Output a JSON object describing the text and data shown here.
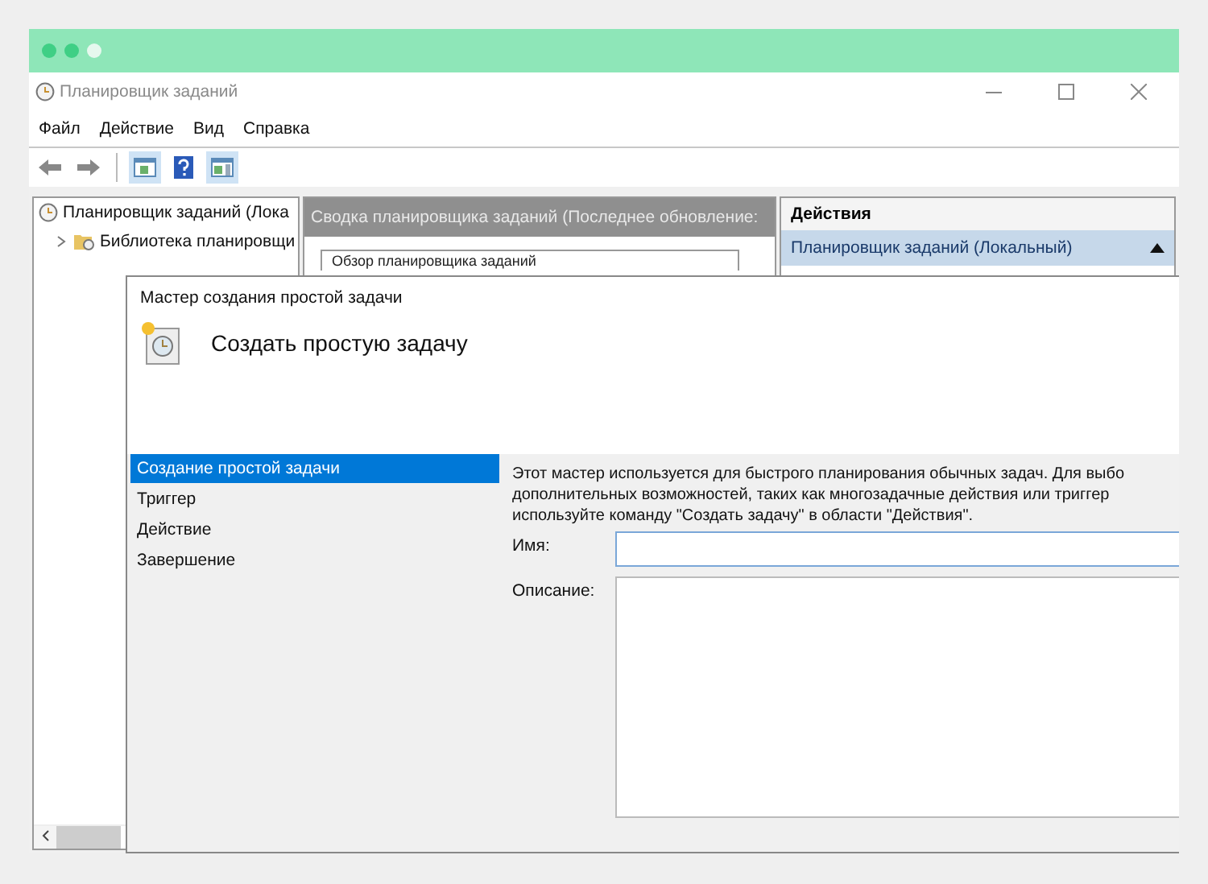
{
  "window": {
    "title": "Планировщик заданий"
  },
  "menu": [
    "Файл",
    "Действие",
    "Вид",
    "Справка"
  ],
  "tree": [
    {
      "label": "Планировщик заданий (Лока",
      "children": [
        {
          "label": "Библиотека планировщи",
          "expanded": false
        }
      ]
    }
  ],
  "summary": {
    "header": "Сводка планировщика заданий (Последнее обновление:",
    "overview": "Обзор планировщика заданий"
  },
  "actions": {
    "header": "Действия",
    "items": [
      {
        "label": "Планировщик заданий (Локальный)",
        "expanded": true
      }
    ]
  },
  "dialog": {
    "title": "Мастер создания простой задачи",
    "heading": "Создать простую задачу",
    "steps": [
      {
        "label": "Создание простой задачи",
        "selected": true
      },
      {
        "label": "Триггер",
        "selected": false
      },
      {
        "label": "Действие",
        "selected": false
      },
      {
        "label": "Завершение",
        "selected": false
      }
    ],
    "intro": [
      "Этот мастер используется для быстрого планирования обычных задач.  Для выбо",
      "дополнительных возможностей, таких как многозадачные действия или триггер",
      "используйте команду \"Создать задачу\" в области \"Действия\"."
    ],
    "name_label": "Имя:",
    "description_label": "Описание:"
  }
}
